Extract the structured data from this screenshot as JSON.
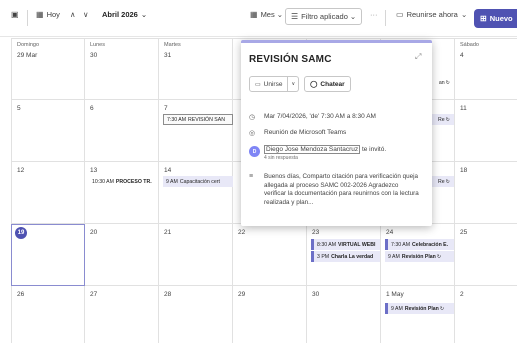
{
  "toolbar": {
    "today_label": "Hoy",
    "month_label": "Abril 2026",
    "view_label": "Mes",
    "filter_label": "Filtro aplicado",
    "more_label": "···",
    "meet_label": "Reunirse ahora",
    "new_label": "Nuevo"
  },
  "day_headers": [
    "Domingo",
    "Lunes",
    "Martes",
    "",
    "",
    "",
    "Sábado"
  ],
  "weeks": [
    [
      "29 Mar",
      "30",
      "31",
      "",
      "",
      "",
      "4"
    ],
    [
      "5",
      "6",
      "7",
      "",
      "",
      "",
      "11"
    ],
    [
      "12",
      "13",
      "14",
      "",
      "",
      "",
      "18"
    ],
    [
      "19",
      "20",
      "21",
      "22",
      "23",
      "24",
      "25"
    ],
    [
      "26",
      "27",
      "28",
      "29",
      "30",
      "1 May",
      "2"
    ]
  ],
  "today": "19",
  "events": {
    "e1": {
      "time": "7:30 AM",
      "title": "REVISIÓN SAN"
    },
    "e2": {
      "time": "10:30 AM",
      "title": "PROCESO TR."
    },
    "e3": {
      "time": "9 AM",
      "title": "Capacitación cert"
    },
    "e4": {
      "time": "8:30 AM",
      "title": "VIRTUAL WEBI"
    },
    "e5": {
      "time": "3 PM",
      "title": "Charla La verdad"
    },
    "e6": {
      "time": "7:30 AM",
      "title": "Celebración E."
    },
    "e7": {
      "time": "9 AM",
      "title": "Revisión Plan"
    },
    "e8": {
      "time": "9 AM",
      "title": "Revisión Plan"
    },
    "p1": {
      "text": "an"
    },
    "p2": {
      "text": "Re"
    },
    "p3": {
      "text": "Re"
    }
  },
  "popup": {
    "title": "REVISIÓN SAMC",
    "join_label": "Unirse",
    "chat_label": "Chatear",
    "datetime": "Mar 7/04/2026, 'de' 7:30 AM a 8:30 AM",
    "location": "Reunión de Microsoft Teams",
    "organizer_initials": "D",
    "organizer_name": "Diego Jose Mendoza Santacruz",
    "invited_suffix": "te invitó.",
    "response": "4 sin respuesta",
    "description": "Buenos días, Comparto citación para verificación queja allegada al proceso SAMC 002-2026 Agradezco verificar la documentación para reunirnos con la lectura realizada y plan..."
  },
  "colors": {
    "accent": "#4f52b2",
    "event_fill": "#e8e8f7",
    "popup_top": "#a8a8e6"
  },
  "icons": [
    "calendar-icon",
    "chevron-up-icon",
    "chevron-down-icon",
    "filter-icon",
    "video-icon",
    "chat-icon",
    "clock-icon",
    "location-icon",
    "description-icon",
    "expand-icon",
    "recurring-icon"
  ]
}
